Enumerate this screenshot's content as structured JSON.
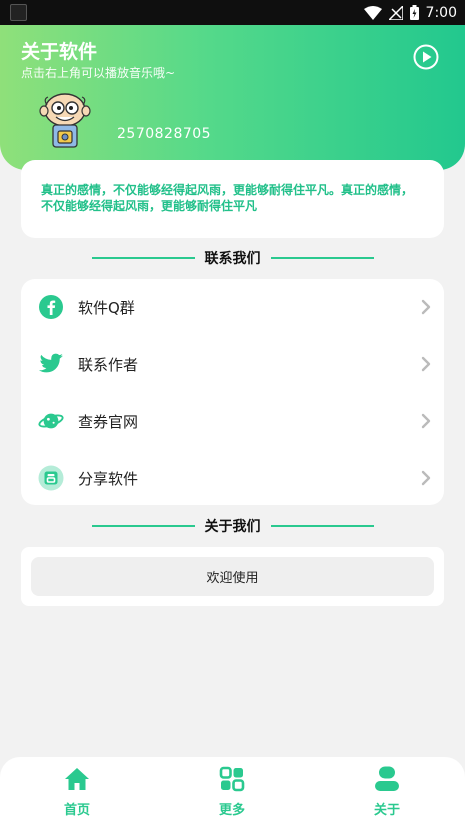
{
  "status_bar": {
    "time": "7:00"
  },
  "header": {
    "title": "关于软件",
    "subtitle": "点击右上角可以播放音乐哦~",
    "qq_number": "2570828705"
  },
  "quote": {
    "text": "真正的感情，不仅能够经得起风雨，更能够耐得住平凡。真正的感情，不仅能够经得起风雨，更能够耐得住平凡"
  },
  "contact_section": {
    "title": "联系我们",
    "items": [
      {
        "label": "软件Q群",
        "icon": "facebook-icon"
      },
      {
        "label": "联系作者",
        "icon": "twitter-icon"
      },
      {
        "label": "查券官网",
        "icon": "planet-icon"
      },
      {
        "label": "分享软件",
        "icon": "share-box-icon"
      }
    ]
  },
  "about_section": {
    "title": "关于我们",
    "button_label": "欢迎使用"
  },
  "bottom_nav": {
    "items": [
      {
        "label": "首页",
        "icon": "home-icon"
      },
      {
        "label": "更多",
        "icon": "apps-icon"
      },
      {
        "label": "关于",
        "icon": "user-icon"
      }
    ]
  },
  "colors": {
    "accent": "#2ac98f",
    "header_gradient_start": "#8fe07a",
    "header_gradient_end": "#22c88e",
    "background": "#f2f2f2"
  }
}
